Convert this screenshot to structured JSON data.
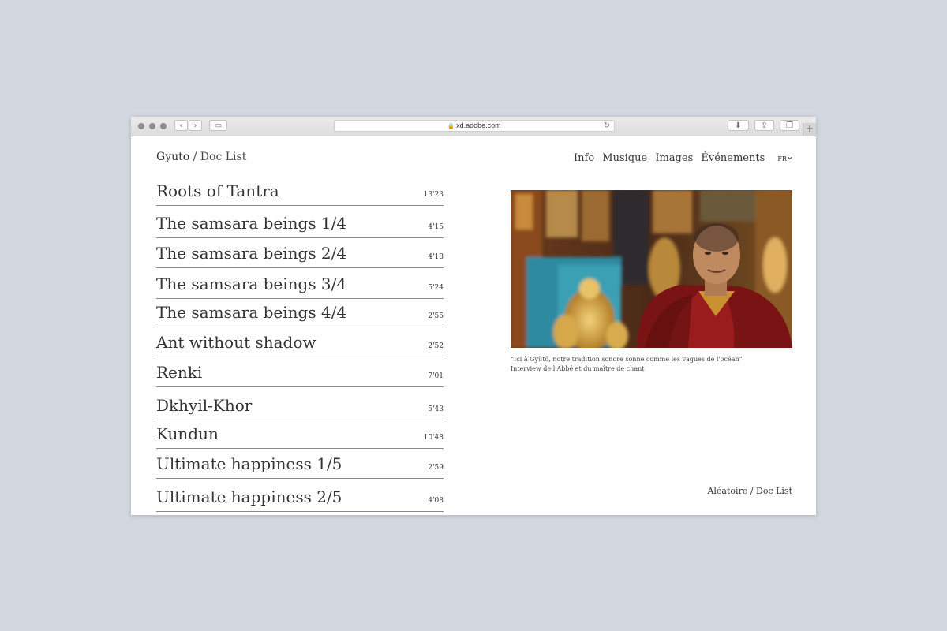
{
  "browser": {
    "url": "xd.adobe.com"
  },
  "header": {
    "brand": "Gyuto",
    "separator": "/",
    "subtitle": "Doc List",
    "nav": [
      "Info",
      "Musique",
      "Images",
      "Événements"
    ],
    "lang": "FR"
  },
  "tracks": [
    {
      "title": "Roots of Tantra",
      "duration": "13'23"
    },
    {
      "title": "The samsara beings 1/4",
      "duration": "4'15"
    },
    {
      "title": "The samsara beings 2/4",
      "duration": "4'18"
    },
    {
      "title": "The samsara beings 3/4",
      "duration": "5'24"
    },
    {
      "title": "The samsara beings 4/4",
      "duration": "2'55"
    },
    {
      "title": "Ant without shadow",
      "duration": "2'52"
    },
    {
      "title": "Renki",
      "duration": "7'01"
    },
    {
      "title": "Dkhyil-Khor",
      "duration": "5'43"
    },
    {
      "title": "Kundun",
      "duration": "10'48"
    },
    {
      "title": "Ultimate happiness 1/5",
      "duration": "2'59"
    },
    {
      "title": "Ultimate happiness 2/5",
      "duration": "4'08"
    }
  ],
  "feature": {
    "caption_line1": "“Ici à Gyütö, notre tradition sonore sonne comme les vagues de l'océan”",
    "caption_line2": "Interview de l'Abbé et du maître de chant"
  },
  "footer": {
    "link": "Aléatoire / Doc List"
  }
}
